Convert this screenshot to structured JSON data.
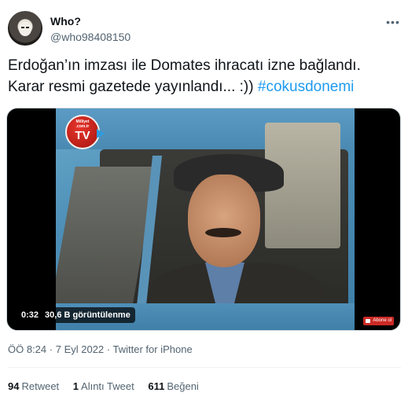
{
  "author": {
    "name": "Who?",
    "handle": "@who98408150",
    "avatar_icon": "masked-face-avatar"
  },
  "more_menu_icon": "ellipsis-icon",
  "tweet": {
    "text_line1": "Erdoğan’ın imzası ile Domates ihracatı izne bağlandı.",
    "text_line2_prefix": "Karar resmi gazetede yayınlandı... :)) ",
    "hashtag": "#cokusdonemi"
  },
  "video": {
    "duration": "0:32",
    "views": "30,6 B görüntülenme",
    "logo_site": "Milliyet .com.tr",
    "logo_text": "TV",
    "subscribe_label": "Abone ol"
  },
  "meta": {
    "time": "ÖÖ 8:24",
    "separator": "·",
    "date": "7 Eyl 2022",
    "source": "Twitter for iPhone"
  },
  "stats": {
    "retweets_count": "94",
    "retweets_label": "Retweet",
    "quotes_count": "1",
    "quotes_label": "Alıntı Tweet",
    "likes_count": "611",
    "likes_label": "Beğeni"
  },
  "colors": {
    "hashtag": "#1d9bf0",
    "secondary_text": "#536471",
    "primary_text": "#0f1419"
  }
}
